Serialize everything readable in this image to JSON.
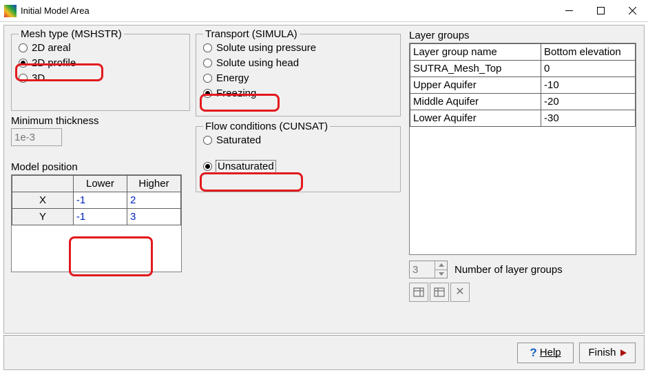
{
  "window": {
    "title": "Initial Model Area"
  },
  "mesh": {
    "legend": "Mesh type (MSHSTR)",
    "options": {
      "areal": "2D areal",
      "profile": "2D profile",
      "three_d": "3D"
    },
    "selected": "profile"
  },
  "min_thickness": {
    "label": "Minimum thickness",
    "value": "1e-3"
  },
  "model_position": {
    "label": "Model position",
    "headers": {
      "lower": "Lower",
      "higher": "Higher"
    },
    "rows": [
      {
        "axis": "X",
        "lower": "-1",
        "higher": "2"
      },
      {
        "axis": "Y",
        "lower": "-1",
        "higher": "3"
      }
    ]
  },
  "transport": {
    "legend": "Transport (SIMULA)",
    "options": {
      "solute_pressure": "Solute using pressure",
      "solute_head": "Solute using head",
      "energy": "Energy",
      "freezing": "Freezing"
    },
    "selected": "freezing"
  },
  "flow": {
    "legend": "Flow conditions (CUNSAT)",
    "options": {
      "saturated": "Saturated",
      "unsaturated": "Unsaturated"
    },
    "selected": "unsaturated"
  },
  "layer_groups": {
    "label": "Layer groups",
    "headers": {
      "name": "Layer group name",
      "bottom": "Bottom elevation"
    },
    "rows": [
      {
        "name": "SUTRA_Mesh_Top",
        "bottom": "0"
      },
      {
        "name": "Upper Aquifer",
        "bottom": "-10"
      },
      {
        "name": "Middle Aquifer",
        "bottom": "-20"
      },
      {
        "name": "Lower Aquifer",
        "bottom": "-30"
      }
    ],
    "count_label": "Number of layer groups",
    "count_value": "3"
  },
  "buttons": {
    "help": "Help",
    "finish": "Finish"
  }
}
